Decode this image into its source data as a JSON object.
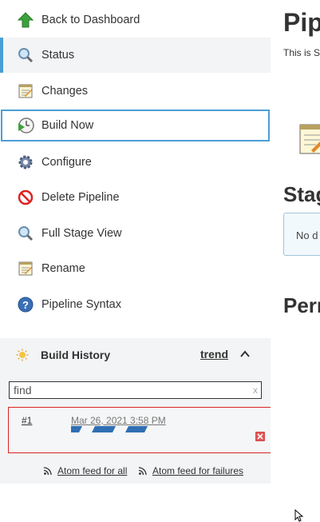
{
  "sidebar": {
    "tasks": [
      {
        "label": "Back to Dashboard",
        "icon": "up-arrow-icon"
      },
      {
        "label": "Status",
        "icon": "magnifier-icon"
      },
      {
        "label": "Changes",
        "icon": "notepad-icon"
      },
      {
        "label": "Build Now",
        "icon": "clock-play-icon"
      },
      {
        "label": "Configure",
        "icon": "gear-icon"
      },
      {
        "label": "Delete Pipeline",
        "icon": "no-entry-icon"
      },
      {
        "label": "Full Stage View",
        "icon": "magnifier-icon"
      },
      {
        "label": "Rename",
        "icon": "notepad-icon"
      },
      {
        "label": "Pipeline Syntax",
        "icon": "help-icon"
      }
    ],
    "active_task": "Status",
    "focused_task": "Build Now"
  },
  "build_history": {
    "title": "Build History",
    "trend_label": "trend",
    "search_placeholder": "find",
    "search_clear": "x",
    "builds": [
      {
        "number": "#1",
        "date": "Mar 26, 2021 3:58 PM",
        "status": "in-progress"
      }
    ],
    "feeds": {
      "all": "Atom feed for all",
      "failures": "Atom feed for failures"
    }
  },
  "main": {
    "title": "Pip",
    "description": "This is S",
    "stage_title": "Stag",
    "stage_text": "No d",
    "perm_title": "Perr"
  },
  "colors": {
    "accent": "#4b9fd5",
    "active_bg": "#f2f4f5",
    "build_border": "#dd2222",
    "progress": "#2f6fb3"
  }
}
